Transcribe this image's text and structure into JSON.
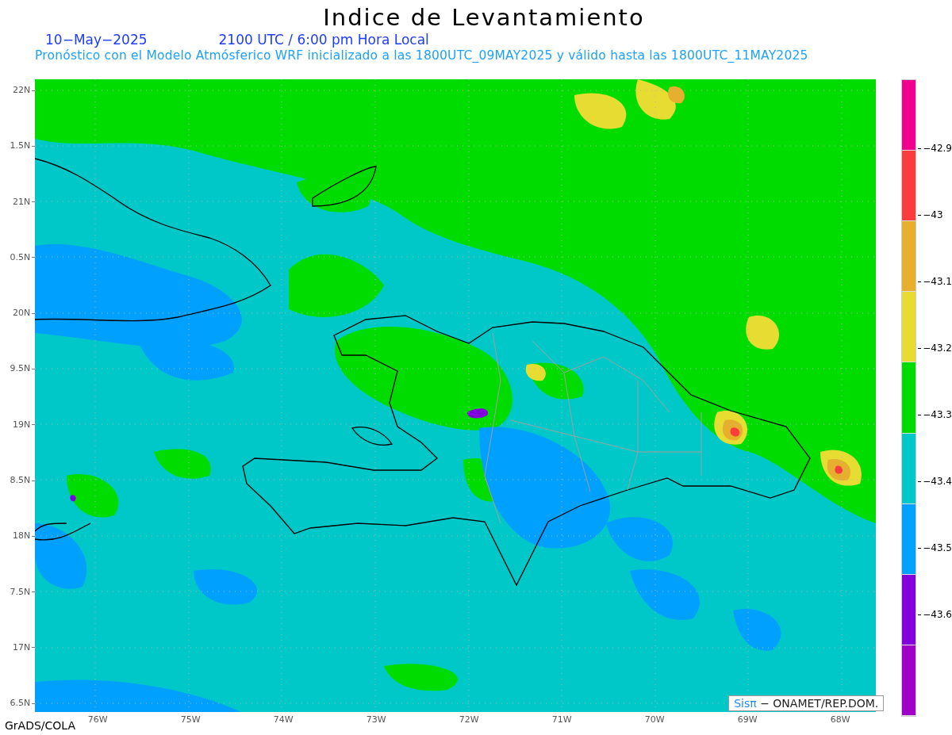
{
  "title": "Indice de Levantamiento",
  "date": "10−May−2025",
  "time": "2100 UTC / 6:00 pm Hora Local",
  "subtitle": "Pronóstico con el Modelo Atmósferico WRF inicializado a las 1800UTC_09MAY2025 y válido hasta las  1800UTC_11MAY2025",
  "y_axis": [
    "22N",
    "1.5N",
    "21N",
    "0.5N",
    "20N",
    "9.5N",
    "19N",
    "8.5N",
    "18N",
    "7.5N",
    "17N",
    "6.5N"
  ],
  "x_axis": [
    "76W",
    "75W",
    "74W",
    "73W",
    "72W",
    "71W",
    "70W",
    "69W",
    "68W"
  ],
  "credit": {
    "brand": "Sisπ",
    "text": "− ONAMET/REP.DOM."
  },
  "software": "GrADS/COLA",
  "legend": {
    "bands": [
      {
        "color": "#f0008c"
      },
      {
        "color": "#fa3c3c"
      },
      {
        "color": "#e6af2d"
      },
      {
        "color": "#e6dc32"
      },
      {
        "color": "#00dc00"
      },
      {
        "color": "#00c8c8"
      },
      {
        "color": "#00a0ff"
      },
      {
        "color": "#8200dc"
      },
      {
        "color": "#a000c8"
      }
    ],
    "ticks": [
      "−42.9",
      "−43",
      "−43.1",
      "−43.2",
      "−43.3",
      "−43.4",
      "−43.5",
      "−43.6"
    ]
  }
}
